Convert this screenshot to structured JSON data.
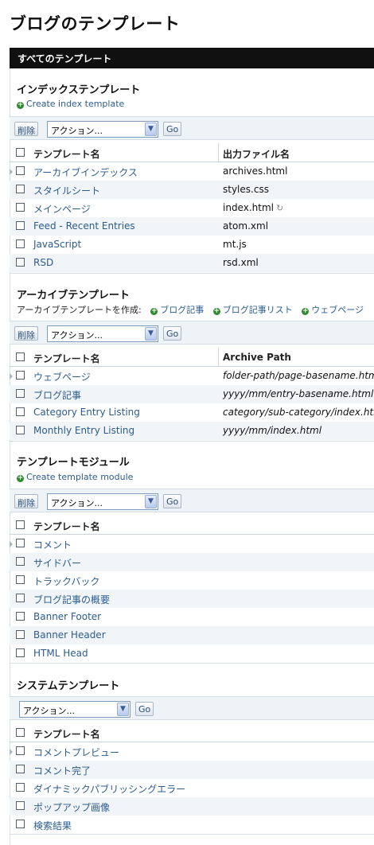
{
  "page_title": "ブログのテンプレート",
  "topbar_label": "すべてのテンプレート",
  "index": {
    "title": "インデックステンプレート",
    "create_link": "Create index template",
    "delete_label": "削除",
    "action_label": "アクション...",
    "go_label": "Go",
    "col_name": "テンプレート名",
    "col_output": "出力ファイル名",
    "rows": [
      {
        "name": "アーカイブインデックス",
        "output": "archives.html"
      },
      {
        "name": "スタイルシート",
        "output": "styles.css"
      },
      {
        "name": "メインページ",
        "output": "index.html"
      },
      {
        "name": "Feed - Recent Entries",
        "output": "atom.xml"
      },
      {
        "name": "JavaScript",
        "output": "mt.js"
      },
      {
        "name": "RSD",
        "output": "rsd.xml"
      }
    ]
  },
  "archive": {
    "title": "アーカイブテンプレート",
    "create_label": "アーカイブテンプレートを作成:",
    "create_links": [
      "ブログ記事",
      "ブログ記事リスト",
      "ウェブページ"
    ],
    "delete_label": "削除",
    "action_label": "アクション...",
    "go_label": "Go",
    "col_name": "テンプレート名",
    "col_path": "Archive Path",
    "rows": [
      {
        "name": "ウェブページ",
        "path": "folder-path/page-basename.html"
      },
      {
        "name": "ブログ記事",
        "path": "yyyy/mm/entry-basename.html"
      },
      {
        "name": "Category Entry Listing",
        "path": "category/sub-category/index.html"
      },
      {
        "name": "Monthly Entry Listing",
        "path": "yyyy/mm/index.html"
      }
    ]
  },
  "modules": {
    "title": "テンプレートモジュール",
    "create_link": "Create template module",
    "delete_label": "削除",
    "action_label": "アクション...",
    "go_label": "Go",
    "col_name": "テンプレート名",
    "rows": [
      "コメント",
      "サイドバー",
      "トラックバック",
      "ブログ記事の概要",
      "Banner Footer",
      "Banner Header",
      "HTML Head"
    ]
  },
  "system": {
    "title": "システムテンプレート",
    "action_label": "アクション...",
    "go_label": "Go",
    "col_name": "テンプレート名",
    "rows": [
      "コメントプレビュー",
      "コメント完了",
      "ダイナミックパブリッシングエラー",
      "ポップアップ画像",
      "検索結果"
    ]
  }
}
